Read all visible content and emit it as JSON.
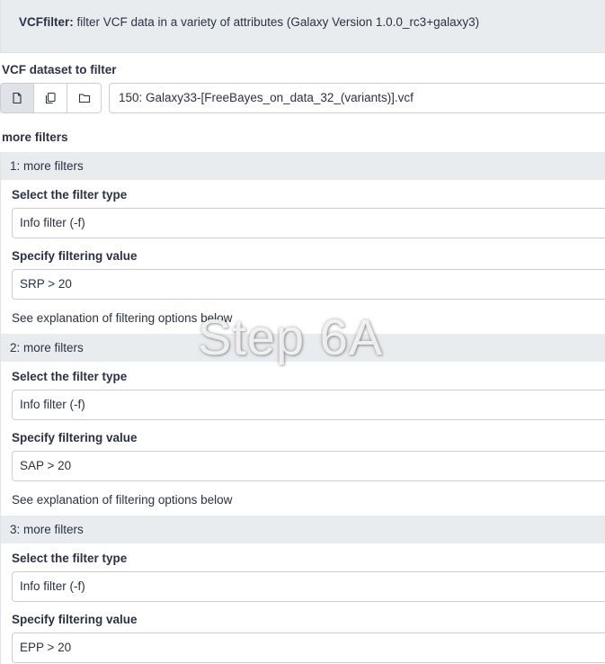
{
  "tool": {
    "name": "VCFfilter:",
    "description": "filter VCF data in a variety of attributes (Galaxy Version 1.0.0_rc3+galaxy3)"
  },
  "input": {
    "label": "VCF dataset to filter",
    "buttons": [
      {
        "icon": "file-icon",
        "active": true
      },
      {
        "icon": "files-icon",
        "active": false
      },
      {
        "icon": "folder-icon",
        "active": false
      }
    ],
    "selected": "150: Galaxy33-[FreeBayes_on_data_32_(variants)].vcf"
  },
  "repeat_title": "more filters",
  "filters": [
    {
      "header": "1: more filters",
      "type_label": "Select the filter type",
      "type_value": "Info filter (-f)",
      "value_label": "Specify filtering value",
      "value": "SRP > 20",
      "help": "See explanation of filtering options below"
    },
    {
      "header": "2: more filters",
      "type_label": "Select the filter type",
      "type_value": "Info filter (-f)",
      "value_label": "Specify filtering value",
      "value": "SAP > 20",
      "help": "See explanation of filtering options below"
    },
    {
      "header": "3: more filters",
      "type_label": "Select the filter type",
      "type_value": "Info filter (-f)",
      "value_label": "Specify filtering value",
      "value": "EPP > 20"
    }
  ],
  "watermark": "Step 6A"
}
